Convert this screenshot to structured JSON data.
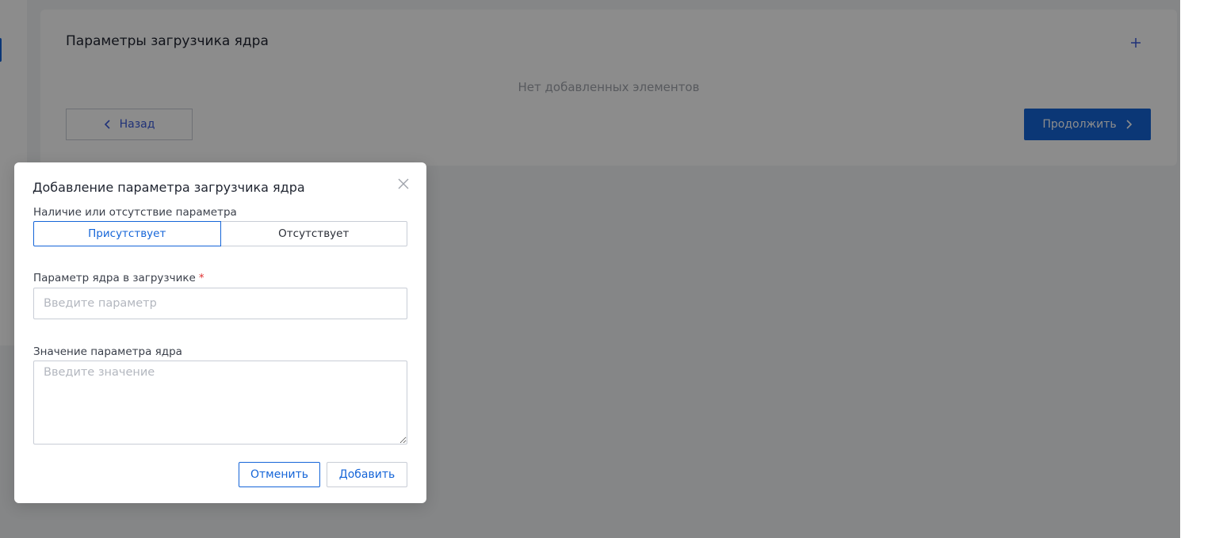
{
  "background_card": {
    "title": "Параметры загрузчика ядра",
    "add_icon": "plus-icon",
    "empty_message": "Нет добавленных элементов",
    "back_label": "Назад",
    "continue_label": "Продолжить"
  },
  "modal": {
    "title": "Добавление параметра загрузчика ядра",
    "close_icon": "close-icon",
    "presence": {
      "label": "Наличие или отсутствие параметра",
      "options": [
        "Присутствует",
        "Отсутствует"
      ],
      "selected": "Присутствует"
    },
    "param_field": {
      "label": "Параметр ядра в загрузчике",
      "required_mark": "*",
      "value": "",
      "placeholder": "Введите параметр"
    },
    "value_field": {
      "label": "Значение параметра ядра",
      "value": "",
      "placeholder": "Введите значение"
    },
    "cancel_label": "Отменить",
    "add_label": "Добавить"
  },
  "colors": {
    "accent": "#1565d8",
    "required": "#e03131",
    "overlay": "rgba(0,0,0,0.45)"
  }
}
